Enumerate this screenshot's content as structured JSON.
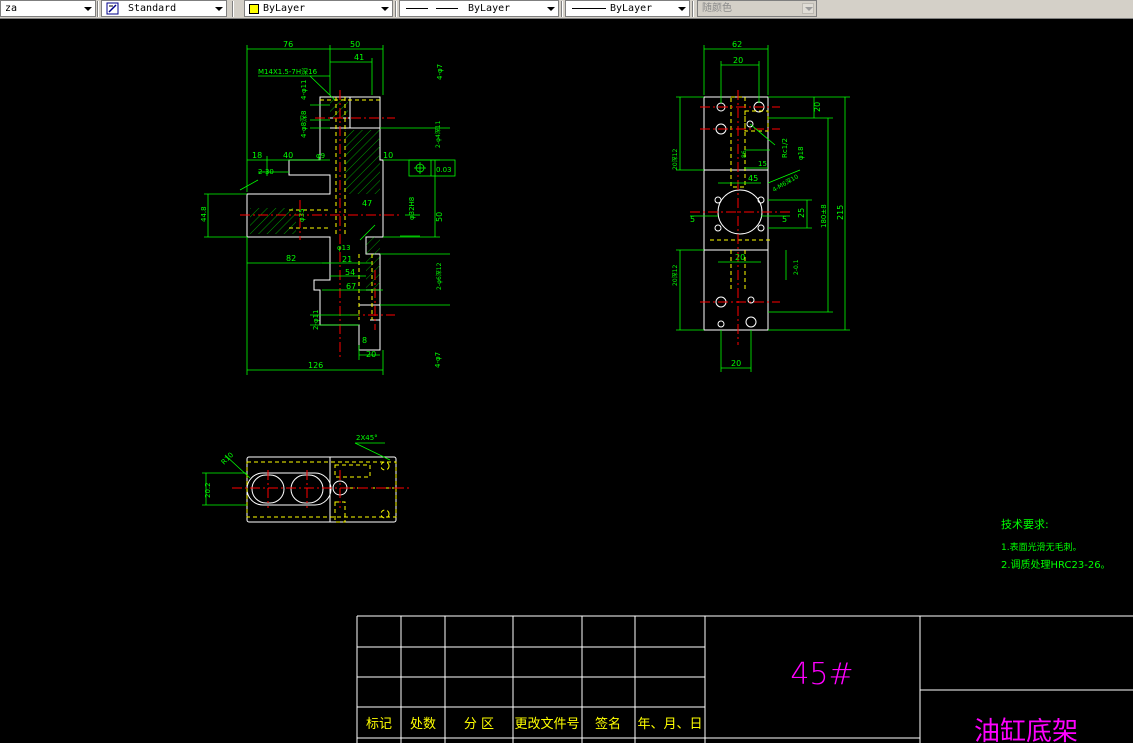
{
  "toolbar": {
    "layer_combo": "za",
    "text_style": "Standard",
    "layer": "ByLayer",
    "layer_color": "#ffff00",
    "linetype": "ByLayer",
    "lineweight": "ByLayer",
    "plot_style": "随颜色"
  },
  "drawing": {
    "front_view": {
      "d76": "76",
      "d50": "50",
      "d41": "41",
      "thread_note": "M14X1.5-7H深16",
      "d4phi7_top": "4-φ7",
      "d4phi11": "4-φ11",
      "d4phi8": "4-φ8深8",
      "d2phi4": "2-φ4深11",
      "d18": "18",
      "d40": "40",
      "d2_30": "2-30",
      "phi9": "φ9",
      "d10": "10",
      "d47": "47",
      "tol_value": "0.03",
      "datum_a": "A",
      "phi32": "φ32H8",
      "phi35": "φ35",
      "d50v": "50",
      "d44": "44.8",
      "d82": "82",
      "phi13": "φ13",
      "d21": "21",
      "d54": "54",
      "d2phi6": "2-φ6深12",
      "d67": "67",
      "d2phi11": "2-φ11",
      "d8": "8",
      "d20": "20",
      "d4phi7_bot": "4-φ7",
      "d126": "126"
    },
    "side_view": {
      "d62": "62",
      "d20_top": "20",
      "d20_right": "20",
      "d20lbl": "20深12",
      "rc": "Rc1/2",
      "phi18": "φ18",
      "d15": "15",
      "d45": "45",
      "d4m6": "4-M6深10",
      "d5_left": "5",
      "d5_right": "5",
      "d25": "25",
      "d180": "180±8",
      "d215": "215",
      "d20_mid": "20",
      "d20lbl2": "20深12",
      "d2_01": "2-0.1",
      "d20_bot": "20",
      "d86": "86"
    },
    "top_view": {
      "chamfer": "2X45°",
      "r10": "R10",
      "d20_2": "20.2"
    },
    "tech_req": {
      "title": "技术要求:",
      "line1": "1.表面光滑无毛刺。",
      "line2": "2.调质处理HRC23-26。"
    },
    "title_block": {
      "col1": "标记",
      "col2": "处数",
      "col3": "分  区",
      "col4": "更改文件号",
      "col5": "签名",
      "col6": "年、月、日",
      "material": "45#",
      "part_name": "油缸底架"
    }
  },
  "colors": {
    "outline": "#ffffff",
    "dimension": "#00ff00",
    "center": "#ff0000",
    "hidden": "#ffff00",
    "magenta": "#ff00ff",
    "hatch": "#00ff00"
  }
}
